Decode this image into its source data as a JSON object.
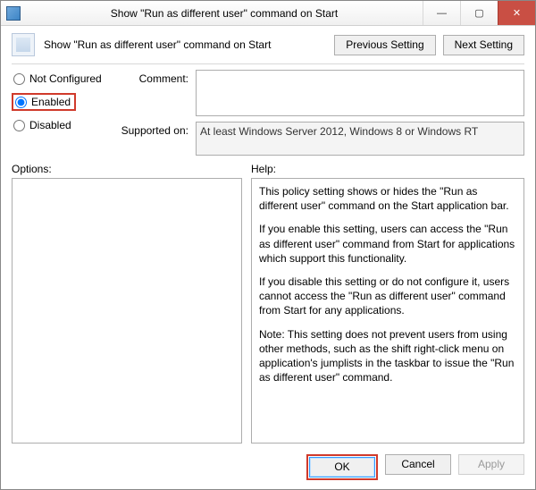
{
  "window": {
    "title": "Show \"Run as different user\" command on Start"
  },
  "header": {
    "policy_name": "Show \"Run as different user\" command on Start",
    "prev_label": "Previous Setting",
    "next_label": "Next Setting"
  },
  "radios": {
    "not_configured": "Not Configured",
    "enabled": "Enabled",
    "disabled": "Disabled",
    "selected": "enabled"
  },
  "comment": {
    "label": "Comment:",
    "value": ""
  },
  "supported": {
    "label": "Supported on:",
    "value": "At least Windows Server 2012, Windows 8 or Windows RT"
  },
  "options": {
    "label": "Options:",
    "body": ""
  },
  "help": {
    "label": "Help:",
    "p1": "This policy setting shows or hides the \"Run as different user\" command on the Start application bar.",
    "p2": "If you enable this setting, users can access the \"Run as different user\" command from Start for applications which support this functionality.",
    "p3": "If you disable this setting or do not configure it, users cannot access the \"Run as different user\" command from Start for any applications.",
    "p4": "Note: This setting does not prevent users from using other methods, such as the shift right-click menu on application's jumplists in the taskbar to issue the \"Run as different user\" command."
  },
  "buttons": {
    "ok": "OK",
    "cancel": "Cancel",
    "apply": "Apply"
  }
}
